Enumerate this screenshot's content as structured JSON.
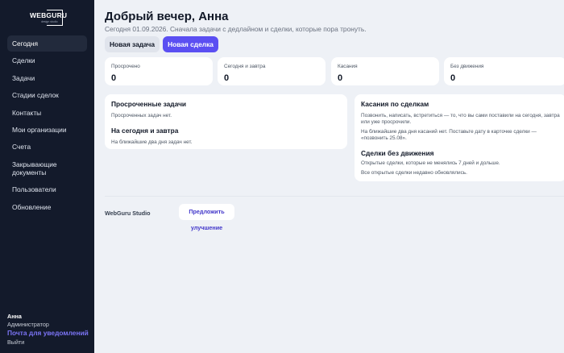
{
  "sidebar": {
    "logo": {
      "text": "WEBGURU",
      "sub": "design studio"
    },
    "items": [
      {
        "label": "Сегодня",
        "active": true
      },
      {
        "label": "Сделки"
      },
      {
        "label": "Задачи"
      },
      {
        "label": "Стадии сделок"
      },
      {
        "label": "Контакты"
      },
      {
        "label": "Мои организации"
      },
      {
        "label": "Счета"
      },
      {
        "label": "Закрывающие документы"
      },
      {
        "label": "Пользователи"
      },
      {
        "label": "Обновление"
      }
    ],
    "user": {
      "name": "Анна",
      "role": "Администратор",
      "notify_label": "Почта для уведомлений",
      "logout_label": "Выйти"
    }
  },
  "header": {
    "title": "Добрый вечер, Анна",
    "subtitle": "Сегодня 01.09.2026. Сначала задачи с дедлайном и сделки, которые пора тронуть.",
    "new_task_label": "Новая задача",
    "new_deal_label": "Новая сделка"
  },
  "stats": [
    {
      "label": "Просрочено",
      "value": "0"
    },
    {
      "label": "Сегодня и завтра",
      "value": "0"
    },
    {
      "label": "Касания",
      "value": "0"
    },
    {
      "label": "Без движения",
      "value": "0"
    }
  ],
  "tasks_card": {
    "overdue_title": "Просроченные задачи",
    "overdue_text": "Просроченных задач нет.",
    "upcoming_title": "На сегодня и завтра",
    "upcoming_text": "На ближайшие два дня задач нет."
  },
  "deals_card": {
    "touches_title": "Касания по сделкам",
    "touches_text": "Позвонить, написать, встретиться — то, что вы сами поставили на сегодня, завтра или уже просрочили.",
    "touches_empty": "На ближайшие два дня касаний нет. Поставьте дату в карточке сделки — «позвонить 25.08».",
    "stale_title": "Сделки без движения",
    "stale_text": "Открытые сделки, которые не менялись 7 дней и дольше.",
    "stale_empty": "Все открытые сделки недавно обновлялись."
  },
  "footer": {
    "brand": "WebGuru Studio",
    "suggest_label": "Предложить улучшение"
  },
  "colors": {
    "sidebar_bg": "#131a2b",
    "accent": "#5b4ff2",
    "link": "#7b74f5",
    "page_bg": "#eef1f6"
  }
}
